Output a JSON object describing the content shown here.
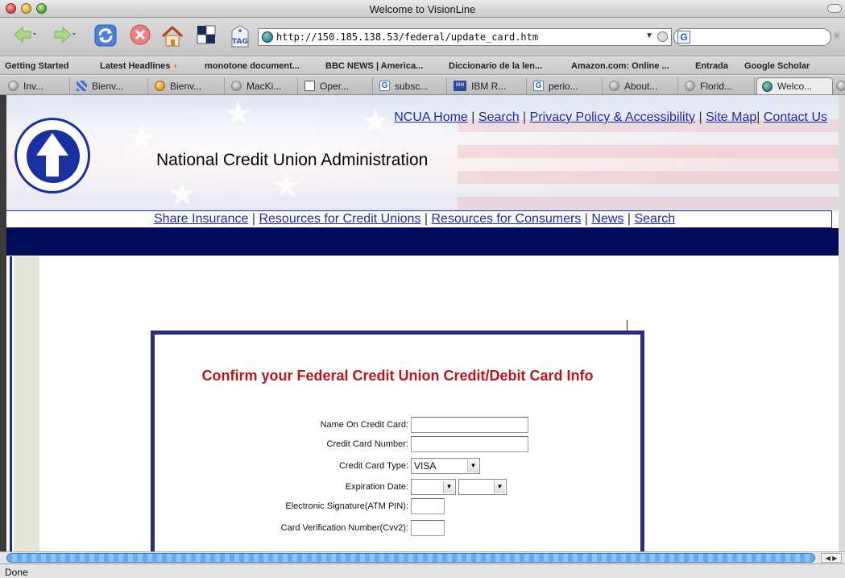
{
  "window": {
    "title": "Welcome to VisionLine"
  },
  "toolbar": {
    "url": "http://150.185.138.53/federal/update_card.htm",
    "tag_label": "TAG",
    "search_engine_glyph": "G"
  },
  "bookmarks": [
    {
      "label": "Getting Started"
    },
    {
      "label": "Latest Headlines"
    },
    {
      "label": "monotone document..."
    },
    {
      "label": "BBC NEWS | America..."
    },
    {
      "label": "Diccionario de la len..."
    },
    {
      "label": "Amazon.com: Online ..."
    },
    {
      "label": "Entrada"
    },
    {
      "label": "Google Scholar"
    }
  ],
  "tabs": [
    {
      "label": "Inv...",
      "icon": "grey-globe-icon"
    },
    {
      "label": "Bienv...",
      "icon": "striped-icon"
    },
    {
      "label": "Bienv...",
      "icon": "orange-icon"
    },
    {
      "label": "MacKi...",
      "icon": "grey-globe-icon"
    },
    {
      "label": "Oper...",
      "icon": "box-icon"
    },
    {
      "label": "subsc...",
      "icon": "google-icon"
    },
    {
      "label": "IBM R...",
      "icon": "ibm-icon"
    },
    {
      "label": "perio...",
      "icon": "google-icon"
    },
    {
      "label": "About...",
      "icon": "grey-globe-icon"
    },
    {
      "label": "Florid...",
      "icon": "grey-globe-icon"
    },
    {
      "label": "Welco...",
      "icon": "globe-icon"
    }
  ],
  "page": {
    "header_links": [
      "NCUA Home",
      "Search",
      "Privacy Policy & Accessibility",
      "Site Map",
      "Contact Us"
    ],
    "org_title": "National Credit Union Administration",
    "nav_links": [
      "Share Insurance",
      "Resources for Credit Unions",
      "Resources for Consumers",
      "News",
      "Search"
    ],
    "form": {
      "heading": "Confirm your Federal Credit Union Credit/Debit Card Info",
      "name_label": "Name On Credit Card:",
      "number_label": "Credit Card Number:",
      "type_label": "Credit Card Type:",
      "type_value": "VISA",
      "expiration_label": "Expiration Date:",
      "pin_label": "Electronic Signature(ATM PIN):",
      "cvv_label": "Card Verification Number(Cvv2):"
    }
  },
  "status": {
    "text": "Done"
  },
  "colors": {
    "form_heading": "#b8161c",
    "form_border": "#2e2a7a",
    "link": "#1a2aa8",
    "dark_band": "#000c5a"
  }
}
